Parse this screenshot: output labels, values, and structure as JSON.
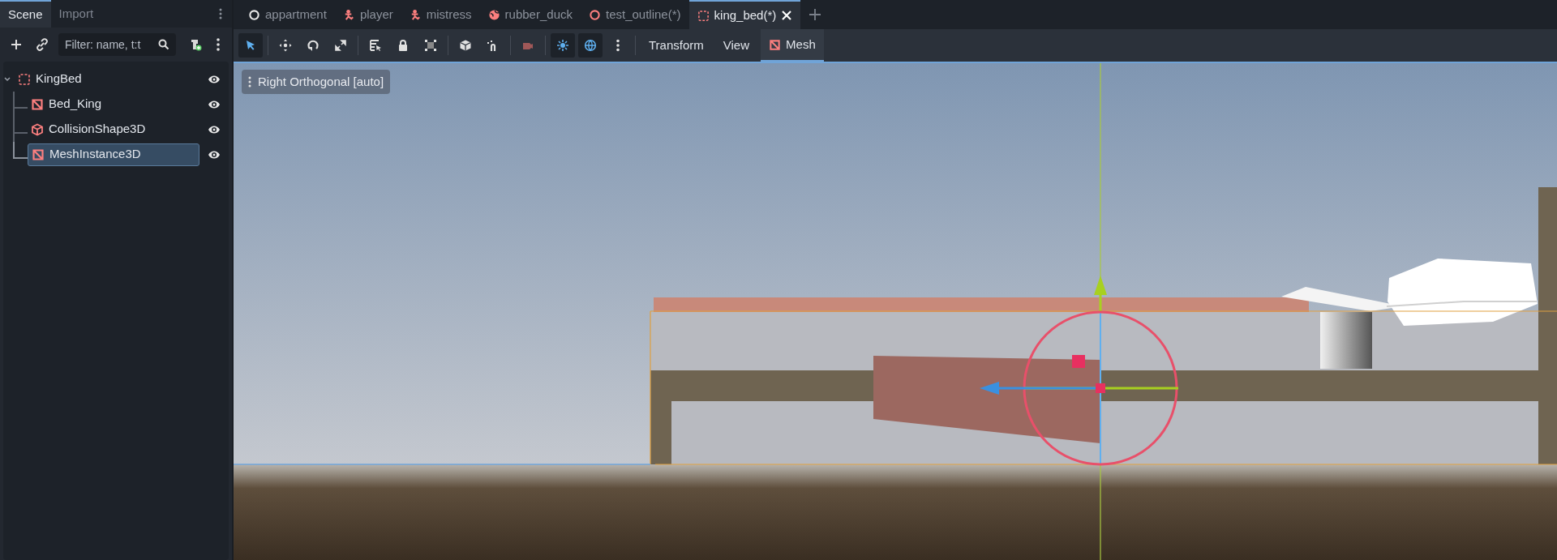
{
  "dock_tabs": [
    {
      "label": "Scene",
      "selected": true
    },
    {
      "label": "Import",
      "selected": false
    }
  ],
  "filter": {
    "placeholder": "Filter: name, t:t"
  },
  "tree": [
    {
      "label": "KingBed",
      "kind": "node3d",
      "expanded": true,
      "selected": false,
      "visible": true,
      "children": [
        {
          "label": "Bed_King",
          "kind": "mesh",
          "selected": false,
          "visible": true
        },
        {
          "label": "CollisionShape3D",
          "kind": "collision",
          "selected": false,
          "visible": true
        },
        {
          "label": "MeshInstance3D",
          "kind": "mesh",
          "selected": true,
          "visible": true
        }
      ]
    }
  ],
  "scene_tabs": [
    {
      "label": "appartment",
      "kind": "ring",
      "selected": false
    },
    {
      "label": "player",
      "kind": "person",
      "selected": false
    },
    {
      "label": "mistress",
      "kind": "person",
      "selected": false
    },
    {
      "label": "rubber_duck",
      "kind": "globe",
      "selected": false
    },
    {
      "label": "test_outline(*)",
      "kind": "redring",
      "selected": false
    },
    {
      "label": "king_bed(*)",
      "kind": "node3d",
      "selected": true
    }
  ],
  "toolbar": [
    {
      "kind": "select",
      "pressed": true
    },
    {
      "kind": "sep"
    },
    {
      "kind": "move",
      "pressed": false
    },
    {
      "kind": "rotate",
      "pressed": false
    },
    {
      "kind": "scale",
      "pressed": false
    },
    {
      "kind": "sep"
    },
    {
      "kind": "list",
      "pressed": false
    },
    {
      "kind": "lock",
      "pressed": false
    },
    {
      "kind": "group",
      "pressed": false
    },
    {
      "kind": "sep"
    },
    {
      "kind": "cube",
      "pressed": false
    },
    {
      "kind": "magnet",
      "pressed": false
    },
    {
      "kind": "sep"
    },
    {
      "kind": "camera",
      "pressed": false
    },
    {
      "kind": "sep"
    },
    {
      "kind": "sun",
      "pressed": true
    },
    {
      "kind": "globe",
      "pressed": true
    },
    {
      "kind": "more",
      "pressed": false
    },
    {
      "kind": "sep"
    }
  ],
  "menus": [
    {
      "label": "Transform",
      "selected": false
    },
    {
      "label": "View",
      "selected": false
    },
    {
      "label": "Mesh",
      "selected": true
    }
  ],
  "viewport": {
    "label": "Right Orthogonal [auto]"
  }
}
